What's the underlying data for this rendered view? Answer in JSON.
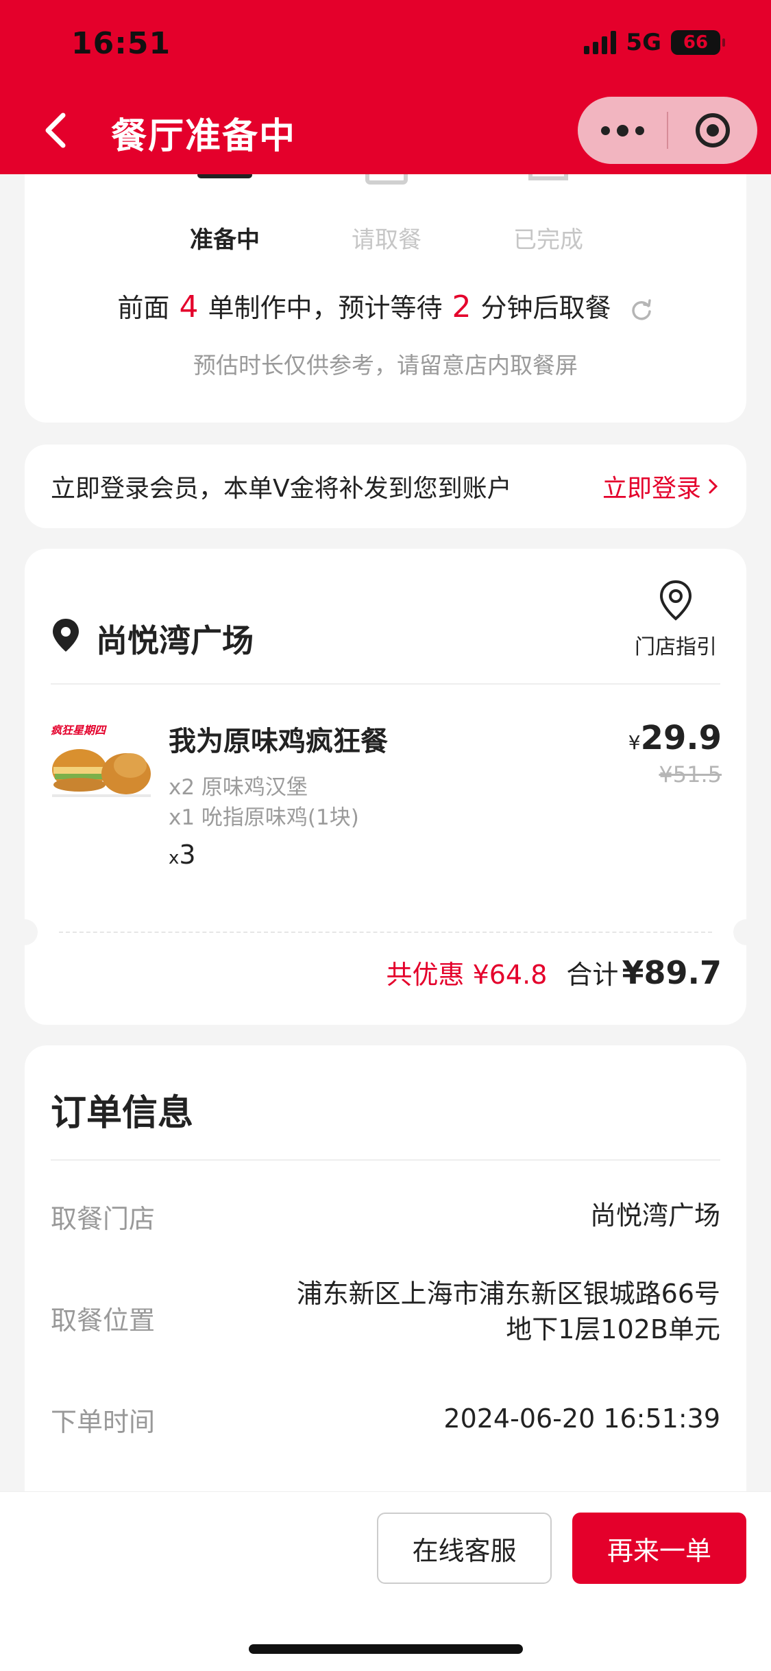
{
  "status_bar": {
    "time": "16:51",
    "network": "5G",
    "battery": "66"
  },
  "header": {
    "title": "餐厅准备中",
    "accent_color": "#e4002b"
  },
  "progress": {
    "steps": [
      {
        "label": "准备中",
        "active": true,
        "icon": "burger-icon"
      },
      {
        "label": "请取餐",
        "active": false,
        "icon": "receipt-icon"
      },
      {
        "label": "已完成",
        "active": false,
        "icon": "bag-check-icon"
      }
    ],
    "wait_prefix": "前面",
    "orders_ahead": "4",
    "wait_middle": "单制作中，预计等待",
    "wait_minutes": "2",
    "wait_suffix": "分钟后取餐",
    "note": "预估时长仅供参考，请留意店内取餐屏"
  },
  "login_banner": {
    "text": "立即登录会员，本单V金将补发到您到账户",
    "link": "立即登录"
  },
  "store": {
    "name": "尚悦湾广场",
    "guide_label": "门店指引"
  },
  "order_item": {
    "name": "我为原味鸡疯狂餐",
    "components": [
      "x2 原味鸡汉堡",
      "x1 吮指原味鸡(1块)"
    ],
    "qty_prefix": "x",
    "qty": "3",
    "currency": "¥",
    "price": "29.9",
    "original_price": "¥51.5",
    "image_caption": "疯狂星期四"
  },
  "totals": {
    "discount_label": "共优惠",
    "discount": "¥64.8",
    "total_label": "合计",
    "total": "¥89.7"
  },
  "order_info": {
    "title": "订单信息",
    "rows": [
      {
        "label": "取餐门店",
        "value": "尚悦湾广场"
      },
      {
        "label": "取餐位置",
        "value_line1": "浦东新区上海市浦东新区银城路66号",
        "value_line2": "地下1层102B单元"
      },
      {
        "label": "下单时间",
        "value": "2024-06-20 16:51:39"
      }
    ]
  },
  "actions": {
    "service": "在线客服",
    "reorder": "再来一单"
  }
}
